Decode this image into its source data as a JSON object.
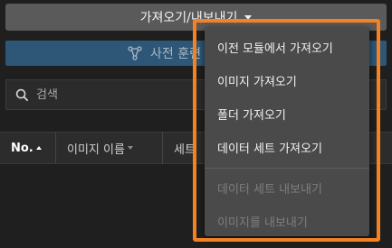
{
  "io_button": {
    "label": "가져오기/내보내기"
  },
  "pretrain": {
    "label": "사전 훈련"
  },
  "search": {
    "placeholder": "검색"
  },
  "table": {
    "columns": [
      {
        "label": "No."
      },
      {
        "label": "이미지 이름"
      },
      {
        "label": "세트"
      }
    ]
  },
  "menu": {
    "items": [
      {
        "label": "이전 모듈에서 가져오기",
        "enabled": true
      },
      {
        "label": "이미지 가져오기",
        "enabled": true
      },
      {
        "label": "폴더 가져오기",
        "enabled": true
      },
      {
        "label": "데이터 세트 가져오기",
        "enabled": true
      },
      {
        "label": "데이터 세트 내보내기",
        "enabled": false
      },
      {
        "label": "이미지를 내보내기",
        "enabled": false
      }
    ]
  },
  "colors": {
    "highlight": "#f58220",
    "menu_bg": "#4a4a4a",
    "pretrain_bg": "#2d5677"
  }
}
